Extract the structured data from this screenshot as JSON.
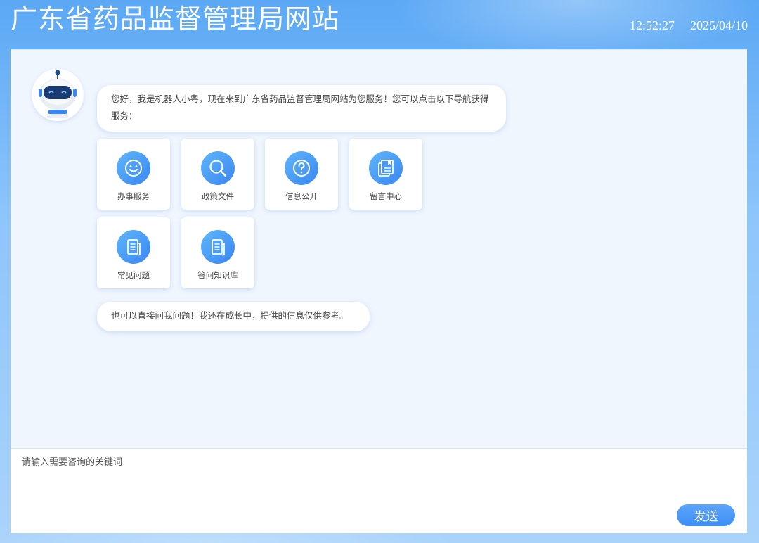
{
  "header": {
    "site_title": "广东省药品监督管理局网站",
    "time": "12:52:27",
    "date": "2025/04/10"
  },
  "chat": {
    "welcome_message": "您好，我是机器人小粤，现在来到广东省药品监督管理局网站为您服务！您可以点击以下导航获得服务：",
    "tip_message": "也可以直接问我问题！我还在成长中，提供的信息仅供参考。"
  },
  "nav_items": [
    {
      "label": "办事服务",
      "icon": "smile-icon"
    },
    {
      "label": "政策文件",
      "icon": "search-icon"
    },
    {
      "label": "信息公开",
      "icon": "question-icon"
    },
    {
      "label": "留言中心",
      "icon": "document-stack-icon"
    },
    {
      "label": "常见问题",
      "icon": "document-icon"
    },
    {
      "label": "答问知识库",
      "icon": "document-icon"
    }
  ],
  "input": {
    "placeholder": "请输入需要咨询的关键词",
    "send_label": "发送"
  },
  "colors": {
    "accent": "#3d8ef5",
    "panel_bg": "#f0f6fe",
    "header_bg": "#5ba8f5"
  }
}
